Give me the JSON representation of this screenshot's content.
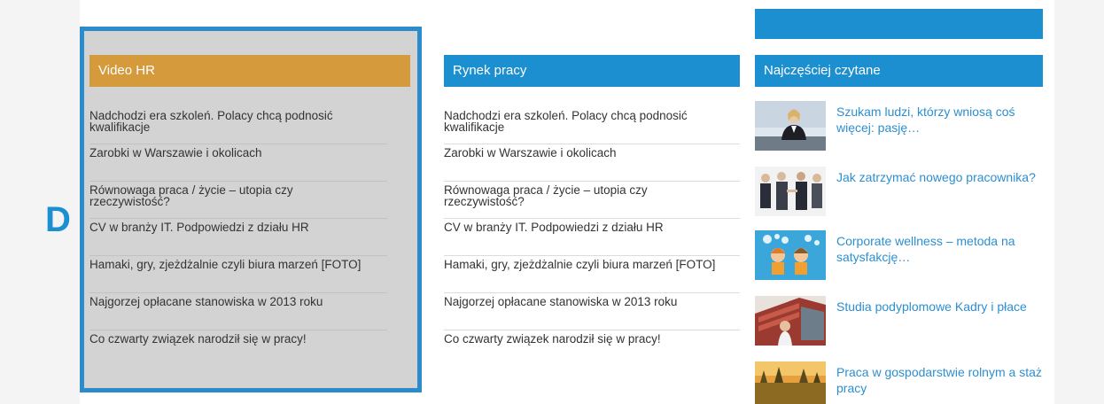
{
  "marker": {
    "letter": "D"
  },
  "video_hr": {
    "title": "Video HR",
    "items": [
      "Nadchodzi era szkoleń. Polacy chcą podnosić kwalifikacje",
      "Zarobki w Warszawie i okolicach",
      "Równowaga praca / życie – utopia czy rzeczywistość?",
      "CV w branży IT. Podpowiedzi z działu HR",
      "Hamaki, gry, zjeżdżalnie czyli biura marzeń [FOTO]",
      "Najgorzej opłacane stanowiska w 2013 roku",
      "Co czwarty związek narodził się w pracy!"
    ]
  },
  "rynek_pracy": {
    "title": "Rynek pracy",
    "items": [
      "Nadchodzi era szkoleń. Polacy chcą podnosić kwalifikacje",
      "Zarobki w Warszawie i okolicach",
      "Równowaga praca / życie – utopia czy rzeczywistość?",
      "CV w branży IT. Podpowiedzi z działu HR",
      "Hamaki, gry, zjeżdżalnie czyli biura marzeń [FOTO]",
      "Najgorzej opłacane stanowiska w 2013 roku",
      "Co czwarty związek narodził się w pracy!"
    ]
  },
  "most_read": {
    "title": "Najczęściej czytane",
    "articles": [
      {
        "title": "Szukam ludzi, którzy wniosą coś więcej: pasję…",
        "thumb_icon": "businesswoman-photo"
      },
      {
        "title": "Jak zatrzymać nowego pracownika?",
        "thumb_icon": "handshake-photo"
      },
      {
        "title": "Corporate wellness – metoda na satysfakcję…",
        "thumb_icon": "cartoon-people-illustration"
      },
      {
        "title": "Studia podyplomowe Kadry i płace",
        "thumb_icon": "student-building-photo"
      },
      {
        "title": "Praca w gospodarstwie rolnym a staż pracy",
        "thumb_icon": "farm-field-photo"
      }
    ]
  },
  "colors": {
    "header_orange": "#d59a3b",
    "header_blue": "#1b8fcf",
    "highlight_border": "#2a8ccb",
    "link_blue": "#2c8fd0"
  }
}
